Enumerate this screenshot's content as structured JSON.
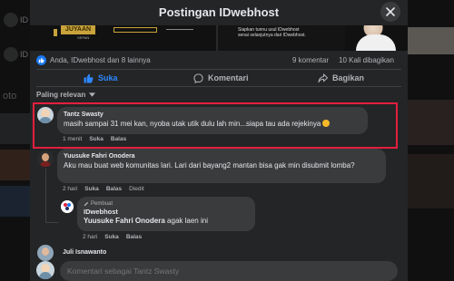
{
  "modal": {
    "title": "Postingan IDwebhost"
  },
  "post_image": {
    "logo_text": "JUYAAN",
    "small_text": "SEPAN",
    "tagline": "Siapkan tunnu usul IDwebhost\nsenai selanjutnya dari IDwebhost."
  },
  "reactions": {
    "summary": "Anda, IDwebhost dan 8 lainnya",
    "comments": "9 komentar",
    "shares": "10 Kali dibagikan"
  },
  "actions": {
    "like": "Suka",
    "comment": "Komentari",
    "share": "Bagikan"
  },
  "sort": {
    "label": "Paling relevan"
  },
  "comments": [
    {
      "name": "Tantz Swasty",
      "text": "masih sampai 31 mei kan, nyoba utak utik dulu lah min...siapa tau ada rejekinya",
      "time": "1 menit",
      "like": "Suka",
      "reply": "Balas"
    },
    {
      "name": "Yuusuke Fahri Onodera",
      "text": "Aku mau buat web komunitas lari. Lari dari bayang2 mantan bisa gak min disubmit lomba?",
      "time": "2 hari",
      "like": "Suka",
      "reply": "Balas",
      "edited": "Diedit"
    },
    {
      "badge": "Pembuat",
      "name": "IDwebhost",
      "mention": "Yuusuke Fahri Onodera",
      "text": "agak laen ini",
      "time": "2 hari",
      "like": "Suka",
      "reply": "Balas"
    },
    {
      "name": "Juli Isnawanto"
    }
  ],
  "input": {
    "placeholder": "Komentari sebagai Tantz Swasty"
  },
  "background": {
    "left_text_1": "ID",
    "left_text_2": "ID",
    "left_text_3": "oto"
  },
  "colors": {
    "accent": "#2d88ff",
    "highlight": "#e41e3f",
    "bubble": "#3a3b3c",
    "surface": "#242526"
  }
}
